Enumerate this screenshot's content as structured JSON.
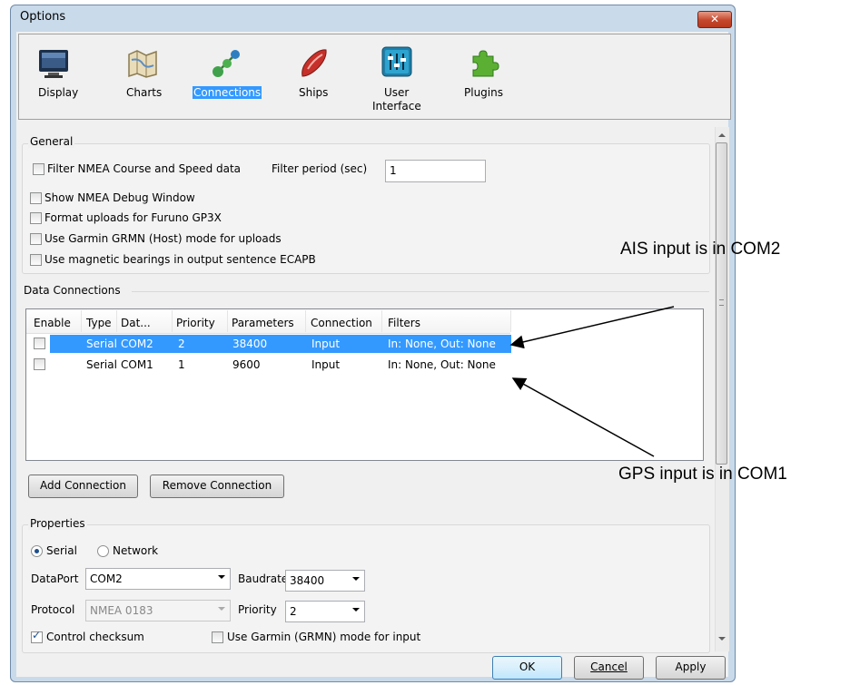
{
  "window": {
    "title": "Options",
    "close_glyph": "✕"
  },
  "toolbar": {
    "items": [
      {
        "label": "Display",
        "icon": "monitor-icon"
      },
      {
        "label": "Charts",
        "icon": "chart-map-icon"
      },
      {
        "label": "Connections",
        "icon": "connections-icon",
        "selected": true
      },
      {
        "label": "Ships",
        "icon": "ship-icon"
      },
      {
        "label": "User",
        "label2": "Interface",
        "icon": "sliders-icon"
      },
      {
        "label": "Plugins",
        "icon": "puzzle-icon"
      }
    ]
  },
  "general": {
    "title": "General",
    "filter_label": "Filter NMEA Course and Speed data",
    "filter_period_label": "Filter period (sec)",
    "filter_period_value": "1",
    "options": [
      "Show NMEA Debug Window",
      "Format uploads for Furuno GP3X",
      "Use Garmin GRMN (Host) mode for uploads",
      "Use magnetic bearings in output sentence ECAPB"
    ]
  },
  "data_connections": {
    "title": "Data Connections",
    "columns": [
      "Enable",
      "Type",
      "Dat...",
      "Priority",
      "Parameters",
      "Connection",
      "Filters"
    ],
    "rows": [
      {
        "type": "Serial",
        "port": "COM2",
        "priority": "2",
        "params": "38400",
        "connection": "Input",
        "filters": "In: None, Out: None",
        "selected": true
      },
      {
        "type": "Serial",
        "port": "COM1",
        "priority": "1",
        "params": "9600",
        "connection": "Input",
        "filters": "In: None, Out: None",
        "selected": false
      }
    ],
    "add_button": "Add Connection",
    "remove_button": "Remove Connection"
  },
  "properties": {
    "title": "Properties",
    "serial_label": "Serial",
    "network_label": "Network",
    "dataport_label": "DataPort",
    "dataport_value": "COM2",
    "baudrate_label": "Baudrate",
    "baudrate_value": "38400",
    "protocol_label": "Protocol",
    "protocol_value": "NMEA 0183",
    "priority_label": "Priority",
    "priority_value": "2",
    "control_checksum": "Control checksum",
    "garmin_input": "Use Garmin (GRMN) mode for input"
  },
  "buttons": {
    "ok": "OK",
    "cancel": "Cancel",
    "apply": "Apply"
  },
  "annotations": {
    "ais": "AIS input is in COM2",
    "gps": "GPS input is in COM1"
  }
}
